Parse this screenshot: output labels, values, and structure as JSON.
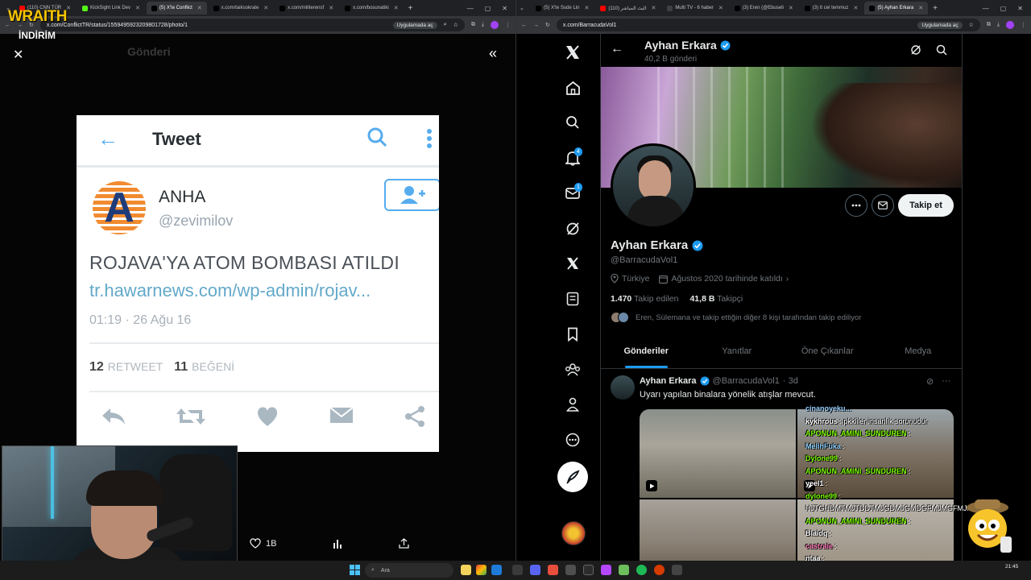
{
  "left_browser": {
    "tabs": [
      {
        "label": "(110) CNN TÜR",
        "color": "#ff0000",
        "active": false
      },
      {
        "label": "KickSight Link Dev",
        "color": "#53fc18",
        "active": false
      },
      {
        "label": "(5) X'te Conflict",
        "color": "#000000",
        "active": true
      },
      {
        "label": "x.com/taiksokrate",
        "color": "#000000",
        "active": false
      },
      {
        "label": "x.com/militerensf",
        "color": "#000000",
        "active": false
      },
      {
        "label": "x.com/bosunatiki",
        "color": "#000000",
        "active": false
      }
    ],
    "url": "x.com/ConflictTR/status/1559495923209801728/photo/1",
    "app_chip": "Uygulamada aç",
    "background_header": "Gönderi"
  },
  "right_browser": {
    "tabs": [
      {
        "label": "(5) X'te Sude Lin",
        "color": "#000000",
        "active": false
      },
      {
        "label": "(110) البث المباشر",
        "color": "#ff0000",
        "active": false
      },
      {
        "label": "Multi TV - 6 haber",
        "color": "#3c4043",
        "active": false
      },
      {
        "label": "(3) Eren (@Ebuseli",
        "color": "#000000",
        "active": false
      },
      {
        "label": "(3) It cel temmuz",
        "color": "#000000",
        "active": false
      },
      {
        "label": "(5) Ayhan Erkara",
        "color": "#000000",
        "active": true
      }
    ],
    "url": "x.com/BarracudaVol1",
    "app_chip": "Uygulamada aç"
  },
  "overlay_logo": {
    "title": "WRAITH",
    "subtitle": "İNDİRİM"
  },
  "photo_tweet": {
    "header_title": "Tweet",
    "avatar_letter": "A",
    "name": "ANHA",
    "handle": "@zevimilov",
    "text": "ROJAVA'YA ATOM BOMBASI ATILDI",
    "link": "tr.hawarnews.com/wp-admin/rojav...",
    "time": "01:19 · 26 Ağu 16",
    "retweets": "12",
    "retweet_label": "RETWEET",
    "likes": "11",
    "likes_label": "BEĞENİ"
  },
  "viewer": {
    "like_count": "1B"
  },
  "profile": {
    "top_name": "Ayhan Erkara",
    "post_count": "40,2 B gönderi",
    "display_name": "Ayhan Erkara",
    "handle": "@BarracudaVol1",
    "location": "Türkiye",
    "joined": "Ağustos 2020 tarihinde katıldı",
    "following_count": "1.470",
    "following_label": "Takip edilen",
    "followers_count": "41,8 B",
    "followers_label": "Takipçi",
    "followed_by": "Eren, Sülemana ve takip ettiğin diğer 8 kişi tarafından takip ediliyor",
    "follow_button": "Takip et",
    "tabs": [
      "Gönderiler",
      "Yanıtlar",
      "Öne Çıkanlar",
      "Medya"
    ]
  },
  "nav": {
    "notifications_badge": "4",
    "messages_badge": "1"
  },
  "post": {
    "name": "Ayhan Erkara",
    "handle": "@BarracudaVol1",
    "age": "· 3d",
    "text": "Uyarı yapılan binalara yönelik atışlar mevcut."
  },
  "chat": [
    {
      "user": "cinanoyeku...",
      "msg": "",
      "color": "#9ad0ff"
    },
    {
      "user": "kykhrous",
      "msg": ": pkkliler insanlık sorunudur",
      "color": "#ffffff"
    },
    {
      "user": "APONUN_AMINI_SUNDUREN",
      "msg": ":",
      "color": "#7cfc00"
    },
    {
      "user": "MelihFuka",
      "msg": ":",
      "color": "#8fd3ff"
    },
    {
      "user": "Dylone99",
      "msg": ":",
      "color": "#7cfc00"
    },
    {
      "user": "APONUN_AMINI_SUNDUREN",
      "msg": ":",
      "color": "#7cfc00"
    },
    {
      "user": "yeel1",
      "msg": ":",
      "color": "#ffffff"
    },
    {
      "user": "dylone99",
      "msg": ":",
      "color": "#7cfc00"
    },
    {
      "user": "",
      "msg": "HJTGHDMTMJTDDTMJGDMJGMDGFMJMGFMJMG",
      "color": "#ffffff"
    },
    {
      "user": "APONUN_AMINI_SUNDUREN",
      "msg": ":",
      "color": "#7cfc00"
    },
    {
      "user": "Blaidq",
      "msg": ":",
      "color": "#ffffff"
    },
    {
      "user": "castrale",
      "msg": ":",
      "color": "#ff7ab6"
    },
    {
      "user": "ntaa",
      "msg": ":",
      "color": "#ffffff"
    }
  ],
  "taskbar": {
    "search_placeholder": "Ara",
    "clock_time": "21:45"
  }
}
